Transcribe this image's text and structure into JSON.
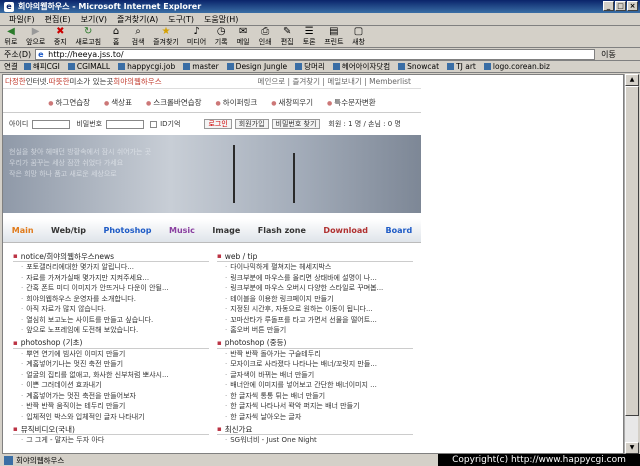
{
  "window": {
    "title": "회야의웹하우스 - Microsoft Internet Explorer"
  },
  "menu": [
    "파일(F)",
    "편집(E)",
    "보기(V)",
    "즐겨찾기(A)",
    "도구(T)",
    "도움말(H)"
  ],
  "toolbar": [
    "뒤로",
    "앞으로",
    "중지",
    "새로고침",
    "홈",
    "검색",
    "즐겨찾기",
    "미디어",
    "기록",
    "메일",
    "인쇄",
    "편집",
    "토론",
    "프린트",
    "새창"
  ],
  "address": {
    "label": "주소(D)",
    "url": "http://heeya.jss.to/",
    "go": "이동"
  },
  "links": {
    "label": "연결",
    "items": [
      "해피CGI",
      "CGIMALL",
      "happycgi.job",
      "master",
      "Design Jungle",
      "당머리",
      "헤어아이자닷컴",
      "Snowcat",
      "TJ art",
      "logo.corean.biz"
    ]
  },
  "status": {
    "text": "회야의웹하우스",
    "copyright": "Copyright(c) http://www.happycgi.com"
  },
  "site": {
    "topline": {
      "p1": "다정한",
      "p2": " 인터넷. ",
      "p3": "따뜻한",
      "p4": " 미소가 있는곳 ",
      "p5": "희야의웹하우스",
      "right": "메인으로 | 즐겨찾기 | 메일보내기 | Memberlist"
    },
    "categories": [
      "하그연습장",
      "색상표",
      "스크롤바연습장",
      "하이퍼링크",
      "새창띄우기",
      "특수문자변환"
    ],
    "login": {
      "id": "아이디",
      "pw": "비밀번호",
      "remember": "ID기억",
      "login": "로그인",
      "join": "회원가입",
      "find": "비밀번호 찾기",
      "count": "회원 : 1 명 / 손님 : 0 명"
    },
    "banner_text": "현실을 찾아 헤매던 방황속에서 잠시 쉬어가는 곳\n우리가 꿈꾸는 세상 잠깐 쉬었다 가세요\n작은 희망 하나 품고 새로운 세상으로",
    "nav": [
      {
        "label": "Main",
        "color": "#e07a1a"
      },
      {
        "label": "Web/tip",
        "color": "#333333"
      },
      {
        "label": "Photoshop",
        "color": "#1e5bc6"
      },
      {
        "label": "Music",
        "color": "#8a3fa0"
      },
      {
        "label": "Image",
        "color": "#333333"
      },
      {
        "label": "Flash zone",
        "color": "#333333"
      },
      {
        "label": "Download",
        "color": "#b03030"
      },
      {
        "label": "Board",
        "color": "#1e5bc6"
      }
    ],
    "left_boxes": [
      {
        "title": "notice/희야의웹하우스news",
        "items": [
          "포토갤러리에대한 몇가지 알립니다...",
          "자료를 가져가실때 몇가지만 지켜주세요...",
          "간혹 폰트 미디 이미지가 안뜨거나 다운이 안될...",
          "희야의웹하우스 운영자를 소개합니다.",
          "아직 자료가 많지 않습니다.",
          "열심히 보고노는 사이트를 만들고 싶습니다.",
          "앞으로 노프레임에 도전해 보았습니다."
        ]
      },
      {
        "title": "photoshop (기초)",
        "items": [
          "뿌연 연기에 빔사인 이미지 만들기",
          "계홈넣어기나는 멋진 축전 만들기",
          "얼굴의 집티를 없애고, 화사한 신부처럼 뽀샤시...",
          "이쁜 그러데이션 효과내기",
          "계홈넣어가는 멋진 축전을 만들어보자",
          "반짝 반짝 움직이는 테두리 만들기",
          "입체적인 박스와 입체적인 글자 나타내기"
        ]
      },
      {
        "title": "뮤직비디오(국내)",
        "items": [
          "그 그게 - 말자는 두자 아다"
        ]
      }
    ],
    "right_boxes": [
      {
        "title": "web / tip",
        "items": [
          "다이나믹하게 펼쳐지는 헤세지박스",
          "링크부분에 마우스를 올리면 상태바에 설명이 나...",
          "링크부분에 마우스 오버시 다양한 스타일로 꾸며봅...",
          "테이블을 이용한 링크페이지 만들기",
          "지정된 시간후, 자동으로 원하는 이동이 됩니다...",
          "꼬마산타가 루돌프를 타고 가면서 선물을 떨어트...",
          "홈오버 버튼 만들기"
        ]
      },
      {
        "title": "photoshop (중등)",
        "items": [
          "반짝 반짝 돌아가는 구슬테두리",
          "모자이크로 사라졌다 나타나는 배너/꼬릿지 만들...",
          "글자색이 바뀌는 배너 만들기",
          "배너안에 이미지를 넣어보고 간단한 배너이미지 ...",
          "한 글자씩 통통 튀는 배너 만들기",
          "한 글자씩 나타나서 꽉악 퍼지는 배너 만들기",
          "한 글자씩 날아오는 글자"
        ]
      },
      {
        "title": "최신가요",
        "items": [
          "SG워너비 - Just One Night"
        ]
      }
    ]
  }
}
